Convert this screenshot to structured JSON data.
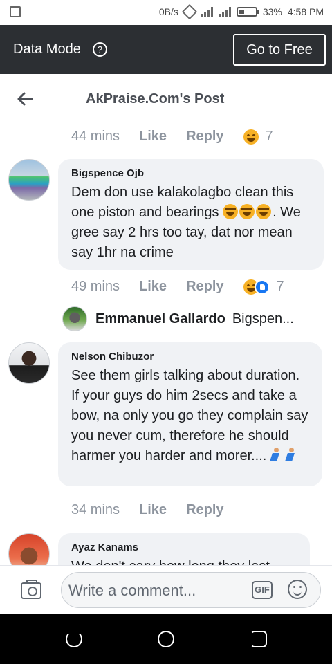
{
  "status_bar": {
    "speed": "0B/s",
    "battery_percent": "33%",
    "time": "4:58 PM",
    "battery_level": 0.33
  },
  "data_mode_bar": {
    "title": "Data Mode",
    "help_glyph": "?",
    "go_free_label": "Go to Free",
    "background": "#2c2f33"
  },
  "header": {
    "title": "AkPraise.Com's Post"
  },
  "comments": [
    {
      "meta": {
        "time": "44 mins",
        "like": "Like",
        "reply": "Reply",
        "reaction_count": "7"
      }
    },
    {
      "author": "Bigspence Ojb",
      "text": "Dem don use kalakolagbo clean this one piston and bearings",
      "text_after_emojis": ". We gree say 2 hrs too tay, dat nor mean say 1hr na crime",
      "meta": {
        "time": "49 mins",
        "like": "Like",
        "reply": "Reply",
        "reaction_count": "7"
      },
      "reply_preview": {
        "author": "Emmanuel Gallardo",
        "snippet": "Bigspen..."
      }
    },
    {
      "author": "Nelson Chibuzor",
      "text": "See them girls talking about duration. If your guys do him 2secs and take a bow, na only you go they complain say you never cum, therefore he should harmer you harder and morer....",
      "meta": {
        "time": "34 mins",
        "like": "Like",
        "reply": "Reply"
      }
    },
    {
      "author": "Ayaz Kanams",
      "text": "We don't cary how long they last"
    }
  ],
  "composer": {
    "placeholder": "Write a comment...",
    "gif_label": "GIF"
  },
  "colors": {
    "bubble": "#f0f2f5",
    "meta_text": "#8d949e",
    "like_blue": "#1877f2",
    "emoji_yellow": "#f7b125"
  }
}
